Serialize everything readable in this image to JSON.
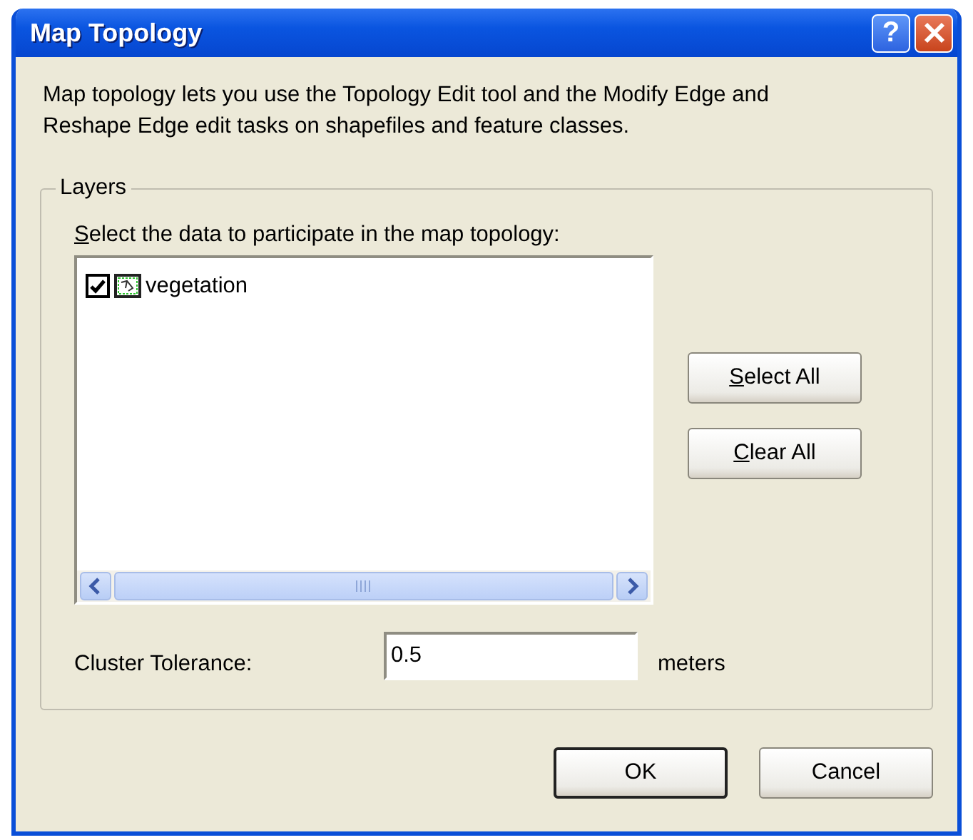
{
  "window": {
    "title": "Map Topology",
    "title_buttons": [
      {
        "kind": "help",
        "label": "?"
      },
      {
        "kind": "close"
      }
    ]
  },
  "description": "Map topology lets you use the Topology Edit tool and the Modify Edge and Reshape Edge edit tasks on shapefiles and feature classes.",
  "layers": {
    "group_label": "Layers",
    "prompt": {
      "text": "Select the data to participate in the map topology:",
      "first_letter_underlined": true
    },
    "items": [
      {
        "label": "vegetation",
        "checked": true
      }
    ],
    "buttons": [
      {
        "label": "Select All",
        "first_letter_underlined": true
      },
      {
        "label": "Clear All",
        "first_letter_underlined": true
      }
    ],
    "cluster_tolerance": {
      "label": "Cluster Tolerance:",
      "value": "0.5",
      "unit": "meters"
    }
  },
  "buttons": [
    {
      "label": "OK",
      "default": true
    },
    {
      "label": "Cancel",
      "default": false
    }
  ]
}
